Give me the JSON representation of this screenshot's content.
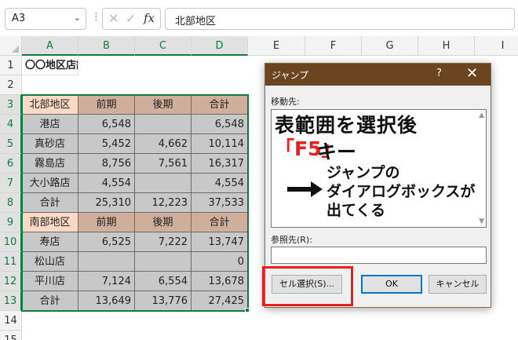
{
  "formula_bar": {
    "name_box": "A3",
    "name_box_arrow_icon": "chevron-down-icon",
    "cancel_icon": "close-icon",
    "enter_icon": "check-icon",
    "function_icon": "fx-icon",
    "function_label": "fx",
    "formula_value": "北部地区"
  },
  "columns": [
    "A",
    "B",
    "C",
    "D",
    "E",
    "F",
    "G",
    "H",
    "I"
  ],
  "rows": [
    "1",
    "2",
    "3",
    "4",
    "5",
    "6",
    "7",
    "8",
    "9",
    "10",
    "11",
    "12",
    "13",
    "14",
    "15"
  ],
  "sheet": {
    "title": "〇〇地区店舗売上高",
    "north_header": [
      "北部地区",
      "前期",
      "後期",
      "合計"
    ],
    "north_rows": [
      [
        "港店",
        "6,548",
        "",
        "6,548"
      ],
      [
        "真砂店",
        "5,452",
        "4,662",
        "10,114"
      ],
      [
        "霧島店",
        "8,756",
        "7,561",
        "16,317"
      ],
      [
        "大小路店",
        "4,554",
        "",
        "4,554"
      ],
      [
        "合計",
        "25,310",
        "12,223",
        "37,533"
      ]
    ],
    "south_header": [
      "南部地区",
      "前期",
      "後期",
      "合計"
    ],
    "south_rows": [
      [
        "寿店",
        "6,525",
        "7,222",
        "13,747"
      ],
      [
        "松山店",
        "",
        "",
        "0"
      ],
      [
        "平川店",
        "7,124",
        "6,554",
        "13,678"
      ],
      [
        "合計",
        "13,649",
        "13,776",
        "27,425"
      ]
    ]
  },
  "dialog": {
    "title": "ジャンプ",
    "help_label": "?",
    "close_icon": "close-icon",
    "goto_label": "移動先:",
    "reference_label": "参照先(R):",
    "reference_value": "",
    "special_button": "セル選択(S)...",
    "ok_button": "OK",
    "cancel_button": "キャンセル"
  },
  "annotation": {
    "line1": "表範囲を選択後",
    "key_label": "「F5」",
    "key_suffix": "キー",
    "sub_line1": "ジャンプの",
    "sub_line2": "ダイアログボックスが",
    "sub_line3": "出てくる",
    "arrow_icon": "arrow-right-icon",
    "highlight_color": "#ee1c1c"
  },
  "colors": {
    "accent_green": "#107c41",
    "dialog_title_bg": "#6b4420",
    "header_tan": "#cfae9c",
    "region_peach": "#fbd9c4",
    "table_gray": "#c8c8c8"
  }
}
